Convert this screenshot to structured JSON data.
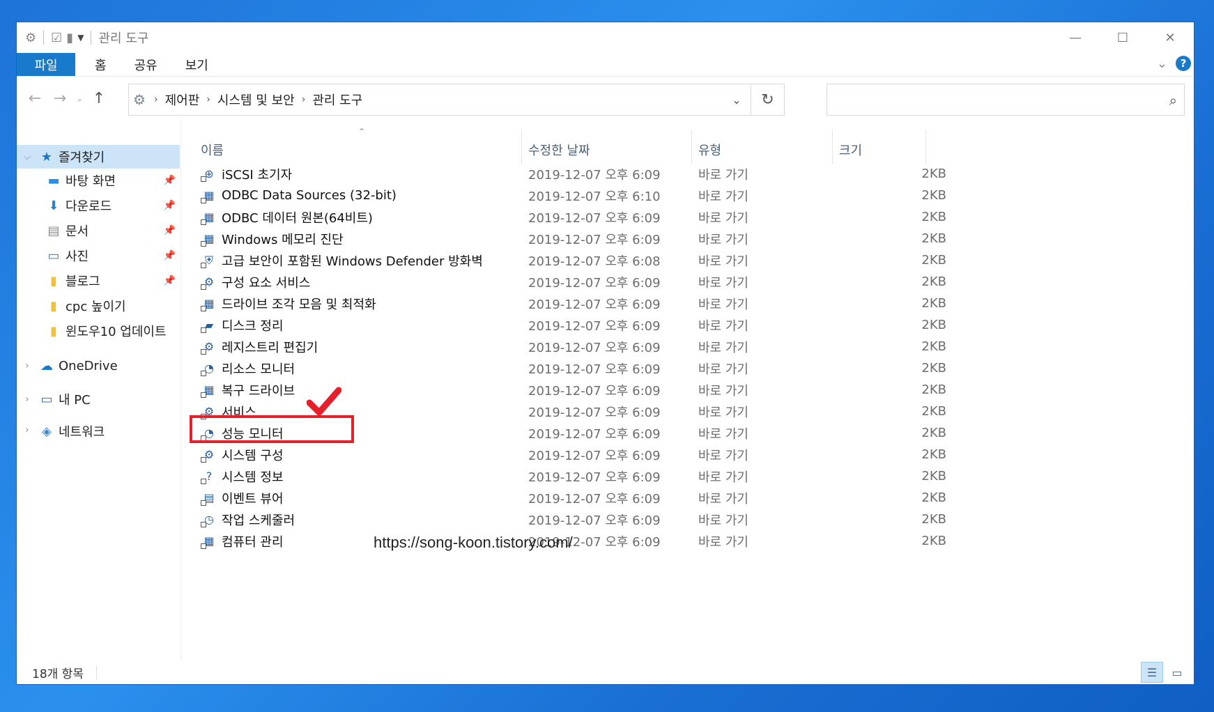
{
  "window": {
    "title": "관리 도구",
    "controls": {
      "minimize": "—",
      "maximize": "☐",
      "close": "✕"
    }
  },
  "ribbon": {
    "tabs": [
      "파일",
      "홈",
      "공유",
      "보기"
    ]
  },
  "address": {
    "crumbs": [
      "제어판",
      "시스템 및 보안",
      "관리 도구"
    ],
    "search_placeholder": ""
  },
  "sidebar": {
    "quick_access": "즐겨찾기",
    "pinned": [
      {
        "label": "바탕 화면",
        "icon": "desktop-icon",
        "pinned": true
      },
      {
        "label": "다운로드",
        "icon": "download-icon",
        "pinned": true
      },
      {
        "label": "문서",
        "icon": "document-icon",
        "pinned": true
      },
      {
        "label": "사진",
        "icon": "picture-icon",
        "pinned": true
      },
      {
        "label": "블로그",
        "icon": "folder-icon",
        "pinned": true
      },
      {
        "label": "cpc 높이기",
        "icon": "folder-icon",
        "pinned": false
      },
      {
        "label": "윈도우10 업데이트",
        "icon": "folder-icon",
        "pinned": false
      }
    ],
    "onedrive": "OneDrive",
    "this_pc": "내 PC",
    "network": "네트워크"
  },
  "columns": {
    "name": "이름",
    "date": "수정한 날짜",
    "type": "유형",
    "size": "크기"
  },
  "files": [
    {
      "name": "iSCSI 초기자",
      "date": "2019-12-07 오후 6:09",
      "type": "바로 가기",
      "size": "2KB"
    },
    {
      "name": "ODBC Data Sources (32-bit)",
      "date": "2019-12-07 오후 6:10",
      "type": "바로 가기",
      "size": "2KB"
    },
    {
      "name": "ODBC 데이터 원본(64비트)",
      "date": "2019-12-07 오후 6:09",
      "type": "바로 가기",
      "size": "2KB"
    },
    {
      "name": "Windows 메모리 진단",
      "date": "2019-12-07 오후 6:09",
      "type": "바로 가기",
      "size": "2KB"
    },
    {
      "name": "고급 보안이 포함된 Windows Defender 방화벽",
      "date": "2019-12-07 오후 6:08",
      "type": "바로 가기",
      "size": "2KB"
    },
    {
      "name": "구성 요소 서비스",
      "date": "2019-12-07 오후 6:09",
      "type": "바로 가기",
      "size": "2KB"
    },
    {
      "name": "드라이브 조각 모음 및 최적화",
      "date": "2019-12-07 오후 6:09",
      "type": "바로 가기",
      "size": "2KB"
    },
    {
      "name": "디스크 정리",
      "date": "2019-12-07 오후 6:09",
      "type": "바로 가기",
      "size": "2KB"
    },
    {
      "name": "레지스트리 편집기",
      "date": "2019-12-07 오후 6:09",
      "type": "바로 가기",
      "size": "2KB"
    },
    {
      "name": "리소스 모니터",
      "date": "2019-12-07 오후 6:09",
      "type": "바로 가기",
      "size": "2KB"
    },
    {
      "name": "복구 드라이브",
      "date": "2019-12-07 오후 6:09",
      "type": "바로 가기",
      "size": "2KB"
    },
    {
      "name": "서비스",
      "date": "2019-12-07 오후 6:09",
      "type": "바로 가기",
      "size": "2KB"
    },
    {
      "name": "성능 모니터",
      "date": "2019-12-07 오후 6:09",
      "type": "바로 가기",
      "size": "2KB"
    },
    {
      "name": "시스템 구성",
      "date": "2019-12-07 오후 6:09",
      "type": "바로 가기",
      "size": "2KB"
    },
    {
      "name": "시스템 정보",
      "date": "2019-12-07 오후 6:09",
      "type": "바로 가기",
      "size": "2KB"
    },
    {
      "name": "이벤트 뷰어",
      "date": "2019-12-07 오후 6:09",
      "type": "바로 가기",
      "size": "2KB"
    },
    {
      "name": "작업 스케줄러",
      "date": "2019-12-07 오후 6:09",
      "type": "바로 가기",
      "size": "2KB"
    },
    {
      "name": "컴퓨터 관리",
      "date": "2019-12-07 오후 6:09",
      "type": "바로 가기",
      "size": "2KB"
    }
  ],
  "watermark": "https://song-koon.tistory.com/",
  "status": {
    "count": "18개 항목"
  },
  "colors": {
    "accent": "#1979ca",
    "highlight": "#e5202a",
    "selection": "#cce4f7"
  }
}
